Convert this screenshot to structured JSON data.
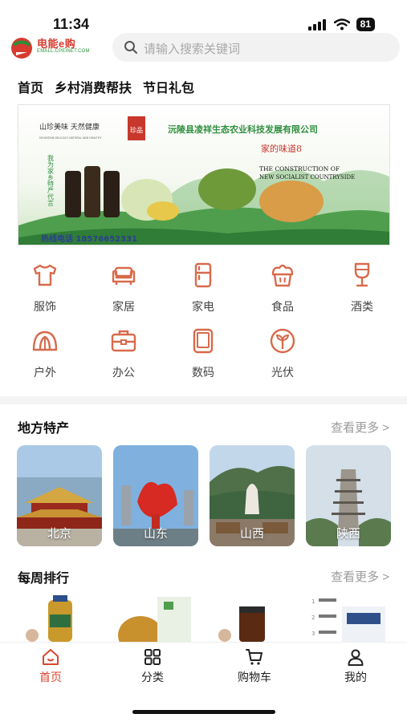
{
  "status": {
    "time": "11:34",
    "battery": "81"
  },
  "header": {
    "logo_title": "电能e购",
    "logo_subtitle": "EMALL.CPEINET.COM",
    "search_placeholder": "请输入搜索关键词"
  },
  "nav_tabs": [
    {
      "label": "首页"
    },
    {
      "label": "乡村消费帮扶"
    },
    {
      "label": "节日礼包"
    }
  ],
  "banner": {
    "slogan": "山珍美味 天然健康",
    "slogan_en": "MOUNTAIN DELICACY NATURAL AND HEALTHY",
    "seal": "珍品",
    "company": "沅陵县凌祥生态农业科技发展有限公司",
    "tagline": "家的味道",
    "tagline_num": "8",
    "side_text": "我为家乡特产代言",
    "construction_line1": "THE CONSTRUCTION OF",
    "construction_line2": "NEW SOCIALIST COUNTRYSIDE",
    "hotline": "热线电话 18576652331"
  },
  "categories": [
    {
      "label": "服饰",
      "icon": "tshirt-icon"
    },
    {
      "label": "家居",
      "icon": "sofa-icon"
    },
    {
      "label": "家电",
      "icon": "fridge-icon"
    },
    {
      "label": "食品",
      "icon": "muffin-icon"
    },
    {
      "label": "酒类",
      "icon": "wine-glass-icon"
    },
    {
      "label": "户外",
      "icon": "tent-icon"
    },
    {
      "label": "办公",
      "icon": "briefcase-icon"
    },
    {
      "label": "数码",
      "icon": "tablet-icon"
    },
    {
      "label": "光伏",
      "icon": "sprout-icon"
    }
  ],
  "local_specialties": {
    "title": "地方特产",
    "see_more": "查看更多 >",
    "regions": [
      {
        "label": "北京"
      },
      {
        "label": "山东"
      },
      {
        "label": "山西"
      },
      {
        "label": "陕西"
      }
    ]
  },
  "weekly_ranking": {
    "title": "每周排行",
    "see_more": "查看更多 >"
  },
  "bottom_nav": [
    {
      "label": "首页",
      "icon": "home-icon"
    },
    {
      "label": "分类",
      "icon": "grid-icon"
    },
    {
      "label": "购物车",
      "icon": "cart-icon"
    },
    {
      "label": "我的",
      "icon": "user-icon"
    }
  ],
  "colors": {
    "accent": "#d9472f",
    "icon": "#d86a4b",
    "banner_green": "#2f8f3e"
  }
}
